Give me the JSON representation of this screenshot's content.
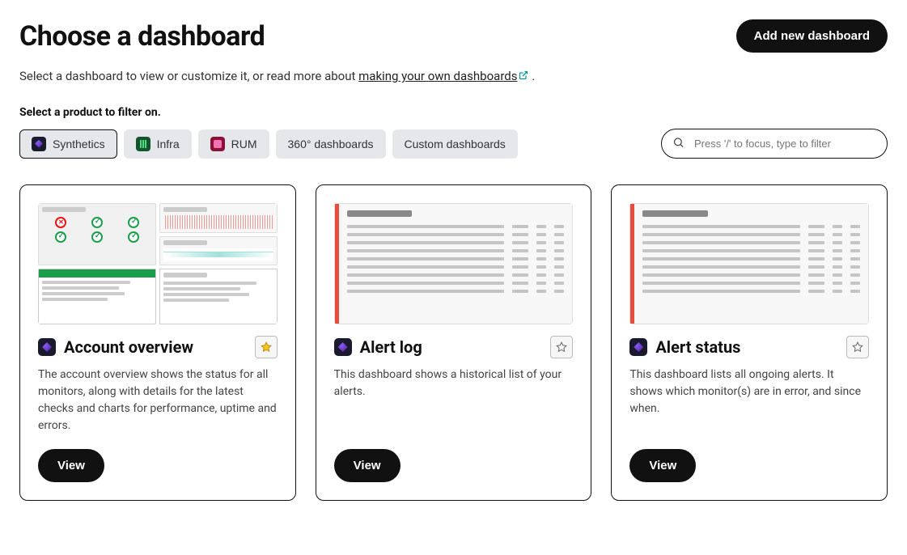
{
  "header": {
    "title": "Choose a dashboard",
    "add_button": "Add new dashboard"
  },
  "intro": {
    "prefix": "Select a dashboard to view or customize it, or read more about ",
    "link_text": "making your own dashboards",
    "suffix": " ."
  },
  "filter": {
    "label": "Select a product to filter on.",
    "pills": [
      {
        "label": "Synthetics",
        "icon": "synth",
        "selected": true
      },
      {
        "label": "Infra",
        "icon": "infra",
        "selected": false
      },
      {
        "label": "RUM",
        "icon": "rum",
        "selected": false
      },
      {
        "label": "360° dashboards",
        "icon": null,
        "selected": false
      },
      {
        "label": "Custom dashboards",
        "icon": null,
        "selected": false
      }
    ],
    "search_placeholder": "Press '/' to focus, type to filter"
  },
  "cards": [
    {
      "title": "Account overview",
      "desc": "The account overview shows the status for all monitors, along with details for the latest checks and charts for performance, uptime and errors.",
      "starred": true,
      "view": "View",
      "thumb": "overview"
    },
    {
      "title": "Alert log",
      "desc": "This dashboard shows a historical list of your alerts.",
      "starred": false,
      "view": "View",
      "thumb": "log"
    },
    {
      "title": "Alert status",
      "desc": "This dashboard lists all ongoing alerts. It shows which monitor(s) are in error, and since when.",
      "starred": false,
      "view": "View",
      "thumb": "log"
    }
  ]
}
